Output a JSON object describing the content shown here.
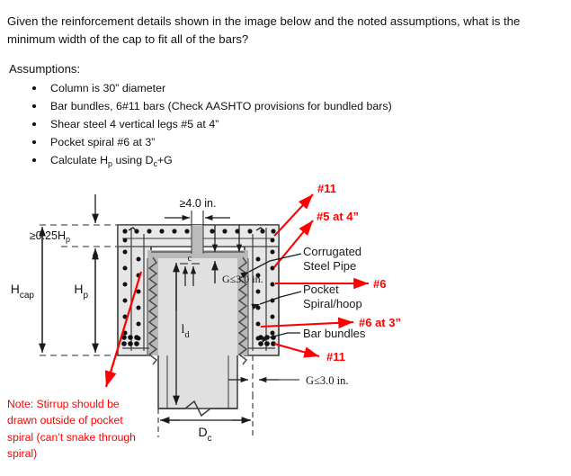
{
  "question": {
    "text": "Given the reinforcement details shown in the image below and the noted assumptions, what is the minimum width of the cap to fit all of the bars?",
    "assumptions_label": "Assumptions:"
  },
  "assumptions": [
    "Column is 30” diameter",
    "Bar bundles, 6#11 bars (Check AASHTO provisions for bundled bars)",
    "Shear steel 4 vertical legs #5 at 4”",
    "Pocket spiral #6 at 3”",
    "Calculate Hₚ using Dₑ+G"
  ],
  "assumptions_rich": [
    {
      "pre": "Column is 30” diameter",
      "sub": "",
      "post": ""
    },
    {
      "pre": "Bar bundles, 6#11 bars (Check AASHTO provisions for bundled bars)",
      "sub": "",
      "post": ""
    },
    {
      "pre": "Shear steel 4 vertical legs #5 at 4”",
      "sub": "",
      "post": ""
    },
    {
      "pre": "Pocket spiral #6 at 3”",
      "sub": "",
      "post": ""
    },
    {
      "pre": "Calculate H",
      "sub": "p",
      "post": " using D"
    }
  ],
  "diagram": {
    "dimensions": {
      "top_clear": "≥4.0 in.",
      "quarter_hp": "≥0.25H",
      "quarter_hp_sub": "p",
      "h_cap": "H",
      "h_cap_sub": "cap",
      "h_p": "H",
      "h_p_sub": "p",
      "l_d": "l",
      "l_d_sub": "d",
      "c_gap": "c",
      "g_vertical": "G≤3.0 in.",
      "g_horizontal": "G≤3.0 in.",
      "d_c": "D",
      "d_c_sub": "c"
    },
    "callouts": {
      "bar_11_top": "#11",
      "stirrup_5": "#5 at 4”",
      "corrugated_pipe": "Corrugated\nSteel Pipe",
      "corrugated_line1": "Corrugated",
      "corrugated_line2": "Steel Pipe",
      "pipe_6": "#6",
      "pocket_spiral": "Pocket\nSpiral/hoop",
      "pocket_line1": "Pocket",
      "pocket_line2": "Spiral/hoop",
      "spiral_6_at_3": "#6 at 3”",
      "bar_bundles": "Bar bundles",
      "bar_11_bottom": "#11"
    },
    "note": "Note: Stirrup should be drawn outside of pocket spiral (can’t snake through spiral)",
    "colors": {
      "annotation_red": "#ff0000",
      "concrete_fill": "#e6e6e6",
      "pipe_fill": "#b5b5b5",
      "outline": "#2b2b2b",
      "rebar_dot": "#111111"
    }
  }
}
